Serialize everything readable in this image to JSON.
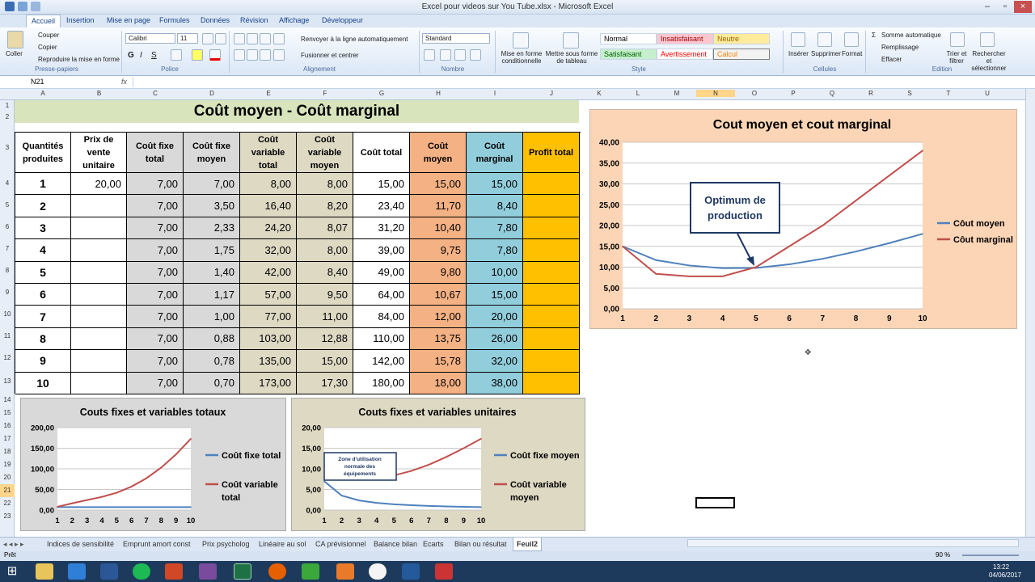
{
  "window": {
    "title": "Excel pour videos sur You Tube.xlsx - Microsoft Excel"
  },
  "ribbon_tabs": [
    "Accueil",
    "Insertion",
    "Mise en page",
    "Formules",
    "Données",
    "Révision",
    "Affichage",
    "Développeur"
  ],
  "ribbon": {
    "clipboard": {
      "paste": "Coller",
      "cut": "Couper",
      "copy": "Copier",
      "format_painter": "Reproduire la mise en forme",
      "group": "Presse-papiers"
    },
    "font": {
      "name": "Calibri",
      "size": "11",
      "group": "Police"
    },
    "alignment": {
      "wrap": "Renvoyer à la ligne automatiquement",
      "merge": "Fusionner et centrer",
      "group": "Alignement"
    },
    "number": {
      "format": "Standard",
      "group": "Nombre"
    },
    "styles": {
      "cond_format": "Mise en forme conditionnelle",
      "table_format": "Mettre sous forme de tableau",
      "normal": "Normal",
      "insuffisant": "Insatisfaisant",
      "neutre": "Neutre",
      "satisfaisant": "Satisfaisant",
      "avertissement": "Avertissement",
      "calcul": "Calcul",
      "group": "Style"
    },
    "cells": {
      "insert": "Insérer",
      "delete": "Supprimer",
      "format": "Format",
      "group": "Cellules"
    },
    "editing": {
      "autosum": "Somme automatique",
      "fill": "Remplissage",
      "clear": "Effacer",
      "sort": "Trier et filtrer",
      "find": "Rechercher et sélectionner",
      "group": "Edition"
    }
  },
  "formula_bar": {
    "name_box": "N21",
    "fx": "fx"
  },
  "columns": [
    "A",
    "B",
    "C",
    "D",
    "E",
    "F",
    "G",
    "H",
    "I",
    "J",
    "K",
    "L",
    "M",
    "N",
    "O",
    "P",
    "Q",
    "R",
    "S",
    "T",
    "U"
  ],
  "rows": [
    "1",
    "2",
    "3",
    "4",
    "5",
    "6",
    "7",
    "8",
    "9",
    "10",
    "11",
    "12",
    "13",
    "14",
    "15",
    "16",
    "17",
    "18",
    "19",
    "20",
    "21",
    "22",
    "23"
  ],
  "sheet": {
    "title": "Coût moyen - Coût marginal",
    "headers": [
      "Quantités produites",
      "Prix de vente unitaire",
      "Coût fixe total",
      "Coût fixe moyen",
      "Coût variable total",
      "Coût variable moyen",
      "Coût total",
      "Coût moyen",
      "Coût marginal",
      "Profit total"
    ],
    "rows": [
      [
        "1",
        "20,00",
        "7,00",
        "7,00",
        "8,00",
        "8,00",
        "15,00",
        "15,00",
        "15,00",
        ""
      ],
      [
        "2",
        "",
        "7,00",
        "3,50",
        "16,40",
        "8,20",
        "23,40",
        "11,70",
        "8,40",
        ""
      ],
      [
        "3",
        "",
        "7,00",
        "2,33",
        "24,20",
        "8,07",
        "31,20",
        "10,40",
        "7,80",
        ""
      ],
      [
        "4",
        "",
        "7,00",
        "1,75",
        "32,00",
        "8,00",
        "39,00",
        "9,75",
        "7,80",
        ""
      ],
      [
        "5",
        "",
        "7,00",
        "1,40",
        "42,00",
        "8,40",
        "49,00",
        "9,80",
        "10,00",
        ""
      ],
      [
        "6",
        "",
        "7,00",
        "1,17",
        "57,00",
        "9,50",
        "64,00",
        "10,67",
        "15,00",
        ""
      ],
      [
        "7",
        "",
        "7,00",
        "1,00",
        "77,00",
        "11,00",
        "84,00",
        "12,00",
        "20,00",
        ""
      ],
      [
        "8",
        "",
        "7,00",
        "0,88",
        "103,00",
        "12,88",
        "110,00",
        "13,75",
        "26,00",
        ""
      ],
      [
        "9",
        "",
        "7,00",
        "0,78",
        "135,00",
        "15,00",
        "142,00",
        "15,78",
        "32,00",
        ""
      ],
      [
        "10",
        "",
        "7,00",
        "0,70",
        "173,00",
        "17,30",
        "180,00",
        "18,00",
        "38,00",
        ""
      ]
    ]
  },
  "chart_data": [
    {
      "type": "line",
      "title": "Cout moyen et cout marginal",
      "x": [
        1,
        2,
        3,
        4,
        5,
        6,
        7,
        8,
        9,
        10
      ],
      "ylim": [
        0,
        40
      ],
      "yticks": [
        "0,00",
        "5,00",
        "10,00",
        "15,00",
        "20,00",
        "25,00",
        "30,00",
        "35,00",
        "40,00"
      ],
      "series": [
        {
          "name": "Côut moyen",
          "values": [
            15,
            11.7,
            10.4,
            9.75,
            9.8,
            10.67,
            12,
            13.75,
            15.78,
            18
          ]
        },
        {
          "name": "Côut marginal",
          "values": [
            15,
            8.4,
            7.8,
            7.8,
            10,
            15,
            20,
            26,
            32,
            38
          ]
        }
      ],
      "annotation": "Optimum de production",
      "legend": "right"
    },
    {
      "type": "line",
      "title": "Couts fixes et variables totaux",
      "x": [
        1,
        2,
        3,
        4,
        5,
        6,
        7,
        8,
        9,
        10
      ],
      "ylim": [
        0,
        200
      ],
      "yticks": [
        "0,00",
        "50,00",
        "100,00",
        "150,00",
        "200,00"
      ],
      "series": [
        {
          "name": "Coût fixe total",
          "values": [
            7,
            7,
            7,
            7,
            7,
            7,
            7,
            7,
            7,
            7
          ]
        },
        {
          "name": "Coût variable total",
          "values": [
            8,
            16.4,
            24.2,
            32,
            42,
            57,
            77,
            103,
            135,
            173
          ]
        }
      ],
      "legend": "right"
    },
    {
      "type": "line",
      "title": "Couts fixes et variables unitaires",
      "x": [
        1,
        2,
        3,
        4,
        5,
        6,
        7,
        8,
        9,
        10
      ],
      "ylim": [
        0,
        20
      ],
      "yticks": [
        "0,00",
        "5,00",
        "10,00",
        "15,00",
        "20,00"
      ],
      "series": [
        {
          "name": "Coût fixe moyen",
          "values": [
            7,
            3.5,
            2.33,
            1.75,
            1.4,
            1.17,
            1,
            0.88,
            0.78,
            0.7
          ]
        },
        {
          "name": "Coût variable moyen",
          "values": [
            8,
            8.2,
            8.07,
            8,
            8.4,
            9.5,
            11,
            12.88,
            15,
            17.3
          ]
        }
      ],
      "annotation": "Zone d'utilisation normale des équipements",
      "legend": "right"
    }
  ],
  "sheet_tabs": [
    "Indices de sensibilité",
    "Emprunt amort const",
    "Prix psycholog",
    "Linéaire au sol",
    "CA prévisionnel",
    "Balance bilan",
    "Ecarts",
    "Bilan ou résultat",
    "Feuil2"
  ],
  "status": {
    "ready": "Prêt",
    "zoom": "90 %"
  },
  "clock": {
    "time": "13:22",
    "date": "04/06/2017"
  },
  "colors": {
    "moyen": "#f4b183",
    "marginal": "#92cddc",
    "profit": "#ffc000",
    "gray": "#d9d9d9",
    "olive": "#ddd9c3",
    "title_bg": "#d8e4bc",
    "chart_bg": "#fbd5b5"
  }
}
